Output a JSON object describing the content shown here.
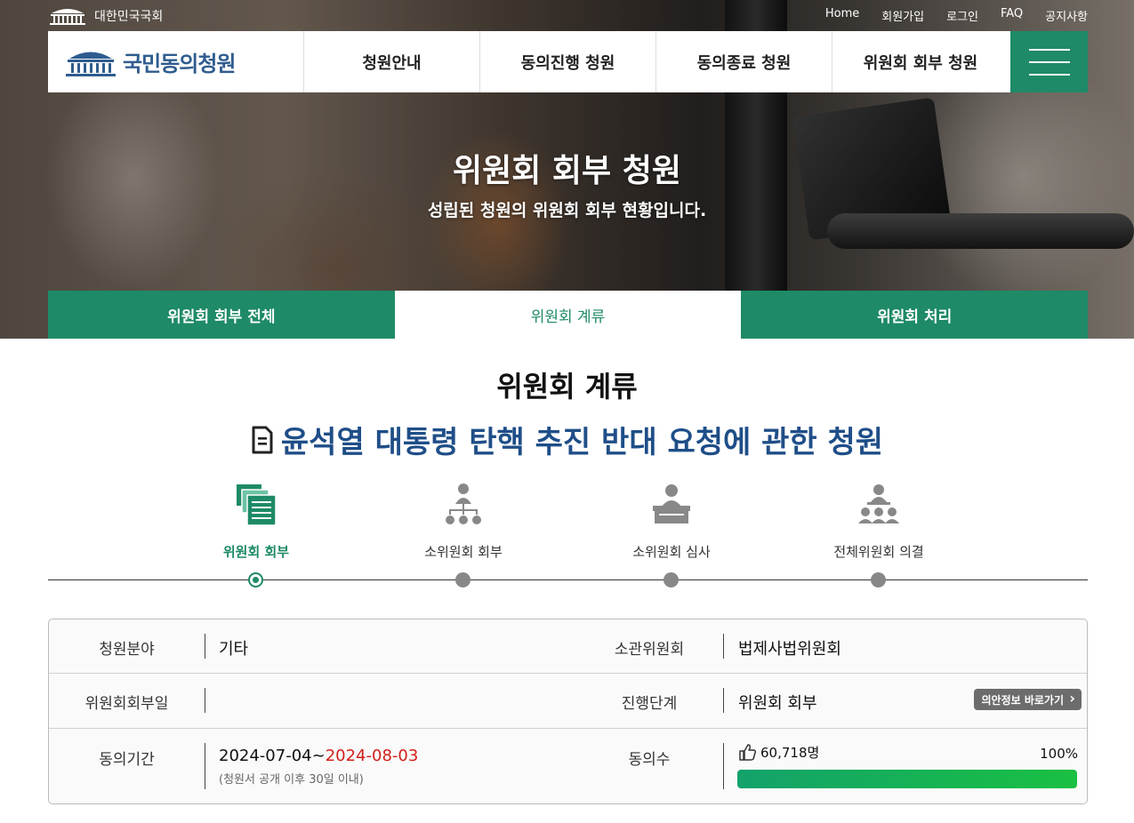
{
  "utility": {
    "national_assembly": "대한민국국회",
    "links": [
      "Home",
      "회원가입",
      "로그인",
      "FAQ",
      "공지사항"
    ]
  },
  "header": {
    "logo_text": "국민동의청원",
    "menu": [
      "청원안내",
      "동의진행 청원",
      "동의종료 청원",
      "위원회 회부 청원"
    ]
  },
  "hero": {
    "title": "위원회 회부 청원",
    "subtitle": "성립된 청원의 위원회 회부 현황입니다."
  },
  "subtabs": [
    {
      "label": "위원회 회부 전체",
      "active": false
    },
    {
      "label": "위원회 계류",
      "active": true
    },
    {
      "label": "위원회 처리",
      "active": false
    }
  ],
  "main": {
    "page_title": "위원회 계류",
    "petition_title": "윤석열 대통령 탄핵 추진 반대 요청에 관한 청원"
  },
  "steps": [
    {
      "label": "위원회 회부",
      "icon": "documents-icon",
      "active": true
    },
    {
      "label": "소위원회 회부",
      "icon": "org-chart-icon",
      "active": false
    },
    {
      "label": "소위원회 심사",
      "icon": "podium-icon",
      "active": false
    },
    {
      "label": "전체위원회 의결",
      "icon": "assembly-icon",
      "active": false
    }
  ],
  "info": {
    "field_label": "청원분야",
    "field_value": "기타",
    "committee_label": "소관위원회",
    "committee_value": "법제사법위원회",
    "referral_date_label": "위원회회부일",
    "referral_date_value": "",
    "stage_label": "진행단계",
    "stage_value": "위원회 회부",
    "law_info_button": "의안정보 바로가기",
    "period_label": "동의기간",
    "period_start": "2024-07-04~",
    "period_end": "2024-08-03",
    "period_note": "(청원서 공개 이후 30일 이내)",
    "consent_label": "동의수",
    "consent_count": "60,718명",
    "consent_percent": "100%",
    "consent_progress": 1.0
  },
  "colors": {
    "brand_green": "#1e8a67",
    "title_blue": "#1f4e88",
    "date_red": "#d0201b"
  }
}
